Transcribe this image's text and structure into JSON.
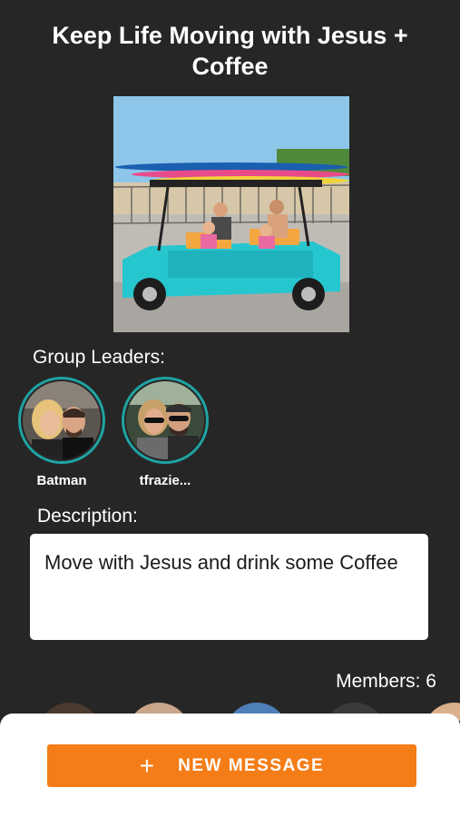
{
  "group": {
    "title": "Keep Life Moving with Jesus + Coffee",
    "cover_image": "family-golf-cart-photo"
  },
  "leaders": {
    "heading": "Group Leaders:",
    "items": [
      {
        "name": "Batman",
        "avatar": "couple-selfie-avatar"
      },
      {
        "name": "tfrazie...",
        "avatar": "couple-sunglasses-avatar"
      }
    ]
  },
  "description": {
    "heading": "Description:",
    "text": "Move with Jesus and drink some Coffee"
  },
  "members": {
    "label": "Members: 6"
  },
  "actions": {
    "new_message_icon": "+",
    "new_message_label": "NEW MESSAGE"
  },
  "colors": {
    "background": "#262626",
    "accent": "#f47d17",
    "avatar_ring": "#1fa3a3"
  }
}
